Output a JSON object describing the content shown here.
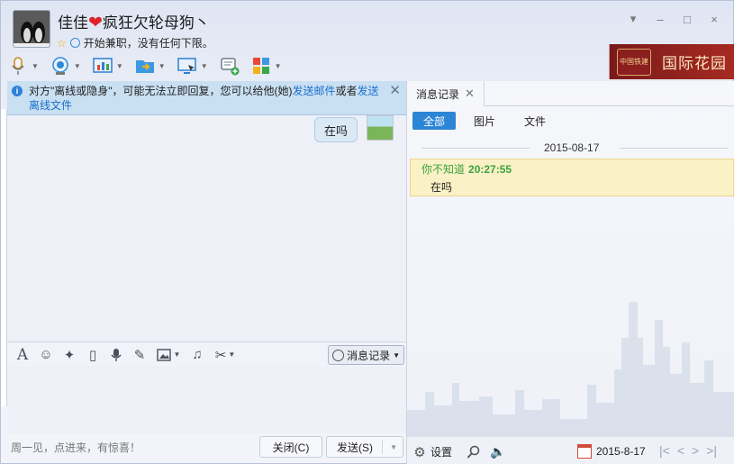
{
  "header": {
    "name_prefix": "佳佳",
    "name_suffix": "疯狂欠轮母狗丶",
    "status_text": "开始兼职，没有任何下限。"
  },
  "window_controls": [
    "▾",
    "–",
    "□",
    "×"
  ],
  "ad": {
    "logo_text": "中国铁建",
    "title": "国际花园"
  },
  "notice": {
    "text_before": "对方\"离线或隐身\"，可能无法立即回复，您可以给他(她)",
    "link_email": "发送邮件",
    "text_or": "或者",
    "link_file": "发送离线文件"
  },
  "chat": {
    "message": "在吗"
  },
  "input_toolbar": {
    "msglog_label": "消息记录"
  },
  "bottom": {
    "tip": "周一见，点进来，有惊喜！",
    "close_label": "关闭(C)",
    "send_label": "发送(S)"
  },
  "right_panel": {
    "tab_label": "消息记录",
    "filters": [
      "全部",
      "图片",
      "文件"
    ],
    "date_separator": "2015-08-17",
    "history": {
      "sender": "你不知道",
      "time": "20:27:55",
      "text": "在吗"
    },
    "settings_label": "设置",
    "current_date": "2015-8-17"
  },
  "colors": {
    "accent": "#2d85d5",
    "notice_bg": "#c9dff2",
    "history_bg": "#fbf1c6",
    "sender_green": "#3ba33f"
  }
}
